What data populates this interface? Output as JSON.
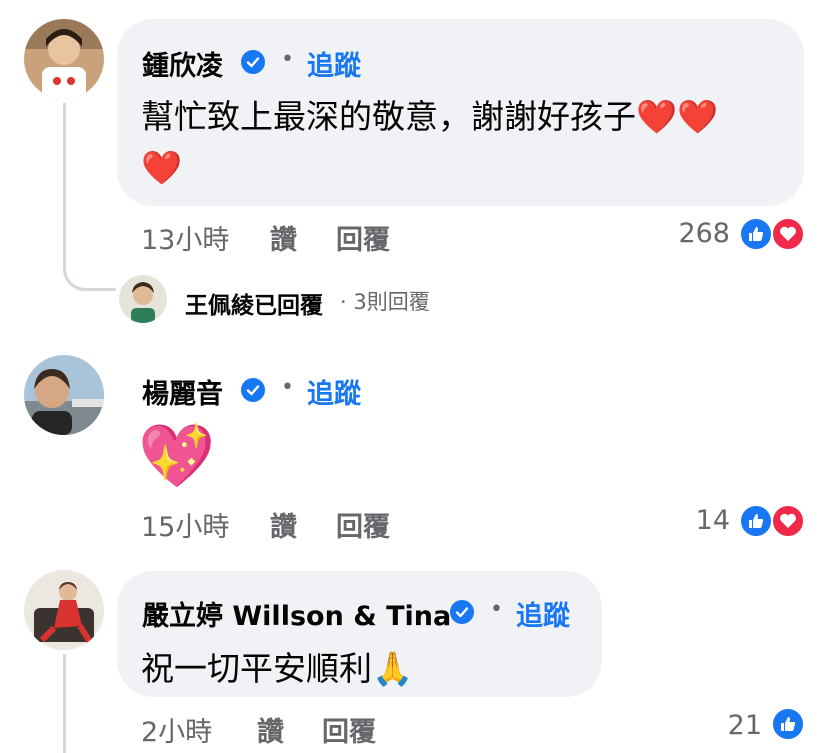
{
  "comments": [
    {
      "name": "鍾欣凌",
      "follow": "追蹤",
      "text_line1": "幫忙致上最深的敬意，謝謝好孩子❤️❤️",
      "text_line2": "❤️",
      "time": "13小時",
      "like": "讚",
      "reply": "回覆",
      "reactions": "268",
      "reaction_icons": [
        "like-icon",
        "love-icon"
      ]
    },
    {
      "name": "楊麗音",
      "follow": "追蹤",
      "text_line1": "💖",
      "time": "15小時",
      "like": "讚",
      "reply": "回覆",
      "reactions": "14",
      "reaction_icons": [
        "like-icon",
        "love-icon"
      ]
    },
    {
      "name": "嚴立婷 Willson & Tina",
      "follow": "追蹤",
      "text_line1": "祝一切平安順利🙏",
      "time": "2小時",
      "like": "讚",
      "reply": "回覆",
      "reactions": "21",
      "reaction_icons": [
        "like-icon"
      ]
    }
  ],
  "reply_preview": {
    "name": "王佩綾已回覆",
    "count": " · 3則回覆"
  },
  "colors": {
    "accent": "#1877f2",
    "love": "#f02849",
    "bubble": "#f0f2f5",
    "meta": "#65676b"
  }
}
